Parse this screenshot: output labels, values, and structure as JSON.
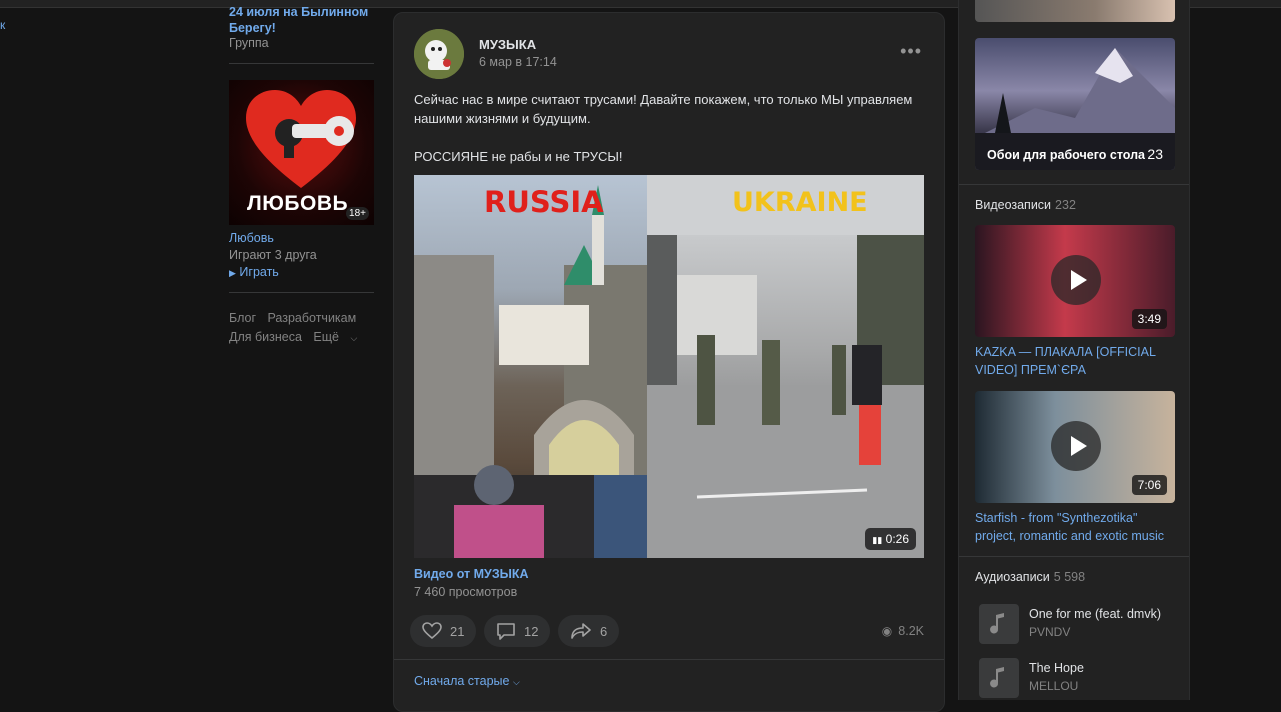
{
  "left_fragment": "к",
  "sidebar": {
    "event_title": "24 июля на Былинном Берегу!",
    "event_type": "Группа",
    "game": {
      "logo_word": "ЛЮБОВЬ",
      "age_badge": "18+",
      "name": "Любовь",
      "friends": "Играют 3 друга",
      "play": "Играть"
    },
    "footer": {
      "blog": "Блог",
      "developers": "Разработчикам",
      "business": "Для бизнеса",
      "more": "Ещё"
    }
  },
  "post": {
    "author": "МУЗЫКА",
    "date": "6 мар в 17:14",
    "text_line1": "Сейчас нас в мире считают трусами! Давайте покажем, что только МЫ управляем нашими жизнями и будущим.",
    "text_line2": "РОССИЯНЕ не рабы и не ТРУСЫ!",
    "video": {
      "left_caption": "RUSSIA",
      "right_caption": "UKRAINE",
      "duration": "0:26",
      "title": "Видео от МУЗЫКА",
      "views": "7 460 просмотров"
    },
    "actions": {
      "likes": "21",
      "comments": "12",
      "shares": "6",
      "views": "8.2K"
    },
    "sort_label": "Сначала старые"
  },
  "rightbar": {
    "album": {
      "label": "Обои для рабочего стола",
      "count": "23"
    },
    "videos_header": "Видеозаписи",
    "videos_count": "232",
    "videos": [
      {
        "title": "KAZKA — ПЛАКАЛА [OFFICIAL VIDEO] ПРЕМ`ЄРА",
        "duration": "3:49"
      },
      {
        "title": "Starfish - from \"Synthezotika\" project, romantic and exotic music",
        "duration": "7:06"
      }
    ],
    "audio_header": "Аудиозаписи",
    "audio_count": "5 598",
    "tracks": [
      {
        "title": "One for me (feat. dmvk)",
        "artist": "PVNDV"
      },
      {
        "title": "The Hope",
        "artist": "MELLOU"
      }
    ]
  }
}
